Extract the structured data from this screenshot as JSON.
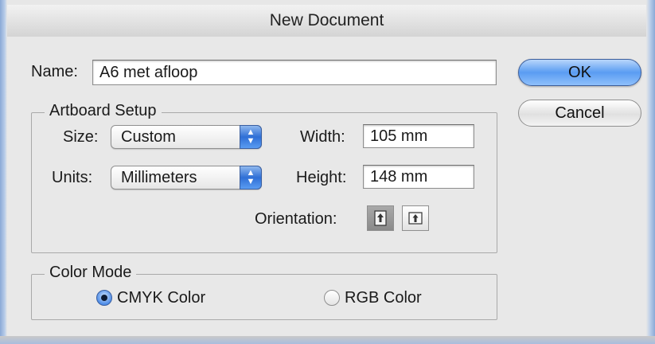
{
  "dialog": {
    "title": "New Document"
  },
  "name_field": {
    "label": "Name:",
    "value": "A6 met afloop"
  },
  "artboard": {
    "group_title": "Artboard Setup",
    "size_label": "Size:",
    "size_value": "Custom",
    "units_label": "Units:",
    "units_value": "Millimeters",
    "width_label": "Width:",
    "width_value": "105 mm",
    "height_label": "Height:",
    "height_value": "148 mm",
    "orientation_label": "Orientation:",
    "orientation_selected": "portrait"
  },
  "color_mode": {
    "group_title": "Color Mode",
    "options": [
      {
        "label": "CMYK Color",
        "selected": true
      },
      {
        "label": "RGB Color",
        "selected": false
      }
    ]
  },
  "buttons": {
    "ok": "OK",
    "cancel": "Cancel"
  },
  "icons": {
    "popup": "up-down-arrows-icon",
    "portrait": "portrait-orientation-icon",
    "landscape": "landscape-orientation-icon"
  }
}
